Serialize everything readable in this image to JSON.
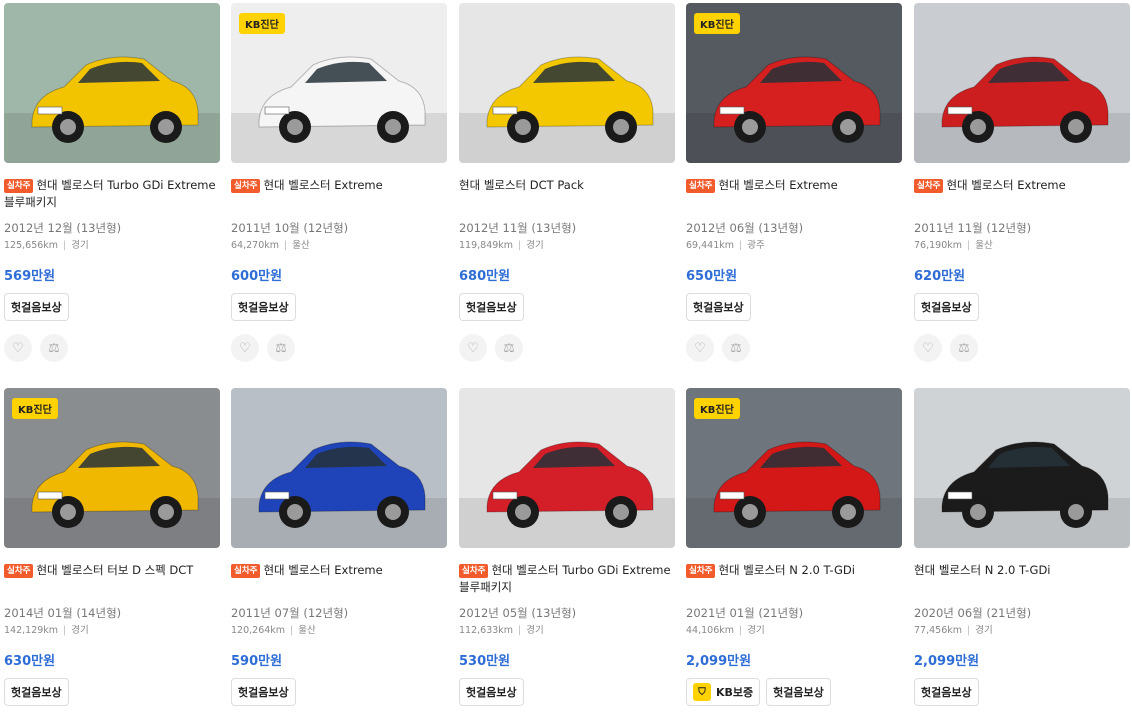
{
  "cards": [
    {
      "tag": "실차주",
      "title": "현대 벨로스터 Turbo GDi Extreme 블루패키지",
      "year": "2012년 12월 (13년형)",
      "km": "125,656km",
      "region": "경기",
      "price": "569만원",
      "chips": [
        "헛걸음보상"
      ],
      "kb": false,
      "car_color": "#f2c400",
      "bg": "#9fb7a8"
    },
    {
      "tag": "실차주",
      "title": "현대 벨로스터 Extreme",
      "year": "2011년 10월 (12년형)",
      "km": "64,270km",
      "region": "울산",
      "price": "600만원",
      "chips": [
        "헛걸음보상"
      ],
      "kb": true,
      "car_color": "#f5f5f5",
      "bg": "#eeeeee"
    },
    {
      "tag": "",
      "title": "현대 벨로스터 DCT Pack",
      "year": "2012년 11월 (13년형)",
      "km": "119,849km",
      "region": "경기",
      "price": "680만원",
      "chips": [
        "헛걸음보상"
      ],
      "kb": false,
      "car_color": "#f3c800",
      "bg": "#e6e6e6"
    },
    {
      "tag": "실차주",
      "title": "현대 벨로스터 Extreme",
      "year": "2012년 06월 (13년형)",
      "km": "69,441km",
      "region": "광주",
      "price": "650만원",
      "chips": [
        "헛걸음보상"
      ],
      "kb": true,
      "car_color": "#d62020",
      "bg": "#555a60"
    },
    {
      "tag": "실차주",
      "title": "현대 벨로스터 Extreme",
      "year": "2011년 11월 (12년형)",
      "km": "76,190km",
      "region": "울산",
      "price": "620만원",
      "chips": [
        "헛걸음보상"
      ],
      "kb": false,
      "car_color": "#cc1e1e",
      "bg": "#c9cdd2"
    },
    {
      "tag": "실차주",
      "title": "현대 벨로스터 터보 D 스펙 DCT",
      "year": "2014년 01월 (14년형)",
      "km": "142,129km",
      "region": "경기",
      "price": "630만원",
      "chips": [
        "헛걸음보상"
      ],
      "kb": true,
      "car_color": "#f0b800",
      "bg": "#8a8d90"
    },
    {
      "tag": "실차주",
      "title": "현대 벨로스터 Extreme",
      "year": "2011년 07월 (12년형)",
      "km": "120,264km",
      "region": "울산",
      "price": "590만원",
      "chips": [
        "헛걸음보상"
      ],
      "kb": false,
      "car_color": "#1f43b8",
      "bg": "#b9bfc6"
    },
    {
      "tag": "실차주",
      "title": "현대 벨로스터 Turbo GDi Extreme 블루패키지",
      "year": "2012년 05월 (13년형)",
      "km": "112,633km",
      "region": "경기",
      "price": "530만원",
      "chips": [
        "헛걸음보상"
      ],
      "kb": false,
      "car_color": "#d41e28",
      "bg": "#e6e6e6"
    },
    {
      "tag": "실차주",
      "title": "현대 벨로스터 N 2.0 T-GDi",
      "year": "2021년 01월 (21년형)",
      "km": "44,106km",
      "region": "경기",
      "price": "2,099만원",
      "chips": [
        "KB보증",
        "헛걸음보상"
      ],
      "kb": true,
      "car_color": "#d41818",
      "bg": "#6f757c"
    },
    {
      "tag": "",
      "title": "현대 벨로스터 N 2.0 T-GDi",
      "year": "2020년 06월 (21년형)",
      "km": "77,456km",
      "region": "경기",
      "price": "2,099만원",
      "chips": [
        "헛걸음보상"
      ],
      "kb": false,
      "car_color": "#1b1b1b",
      "bg": "#d0d3d6"
    }
  ],
  "labels": {
    "kb_badge": "KB진단",
    "kb_shield_icon": "shield-icon",
    "heart_icon": "heart-icon",
    "compare_icon": "scale-icon"
  }
}
